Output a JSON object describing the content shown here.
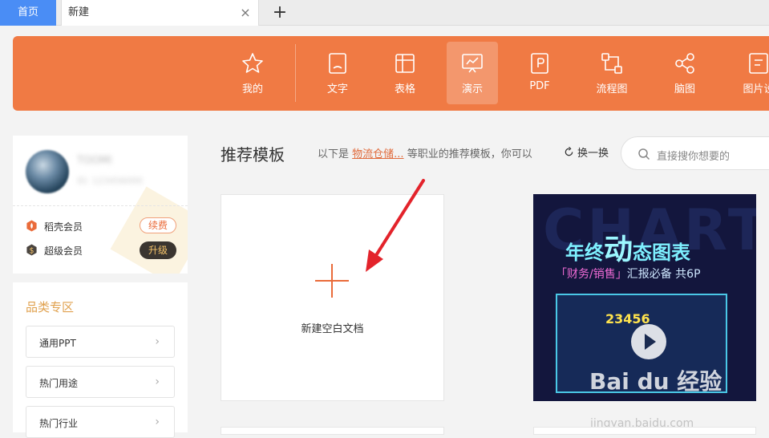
{
  "tabs": {
    "home": "首页",
    "current": "新建",
    "close_icon": "×",
    "add_icon": "+"
  },
  "toolbar": {
    "items": [
      {
        "label": "我的",
        "icon": "star-icon",
        "active": false
      },
      {
        "label": "文字",
        "icon": "document-icon",
        "active": false
      },
      {
        "label": "表格",
        "icon": "table-icon",
        "active": false
      },
      {
        "label": "演示",
        "icon": "presentation-icon",
        "active": true
      },
      {
        "label": "PDF",
        "icon": "pdf-icon",
        "active": false
      },
      {
        "label": "流程图",
        "icon": "flowchart-icon",
        "active": false
      },
      {
        "label": "脑图",
        "icon": "mindmap-icon",
        "active": false
      },
      {
        "label": "图片设",
        "icon": "image-design-icon",
        "active": false
      }
    ],
    "bg_color": "#f07a44"
  },
  "user": {
    "name": "TOOMI",
    "id": "ID: 123456000",
    "memberships": [
      {
        "label": "稻壳会员",
        "action": "续费"
      },
      {
        "label": "超级会员",
        "action": "升级"
      }
    ]
  },
  "categories": {
    "title": "品类专区",
    "items": [
      "通用PPT",
      "热门用途",
      "热门行业"
    ],
    "chevron": "›"
  },
  "recommend": {
    "title": "推荐模板",
    "desc_prefix": "以下是",
    "desc_link": "物流仓储...",
    "desc_suffix": "等职业的推荐模板，你可以",
    "refresh": "换一换"
  },
  "search": {
    "placeholder": "直接搜你想要的"
  },
  "blank_card": {
    "label": "新建空白文档"
  },
  "template_card": {
    "bg_text": "CHART",
    "title_a": "年终",
    "title_big": "动",
    "title_b": "态图表",
    "sub_hl": "「财务/销售」",
    "sub_rest": "汇报必备  共6P",
    "number": "23456"
  },
  "watermark": {
    "brand": "Bai du 经验",
    "url": "jingyan.baidu.com"
  },
  "accent_color": "#ea6b3a"
}
